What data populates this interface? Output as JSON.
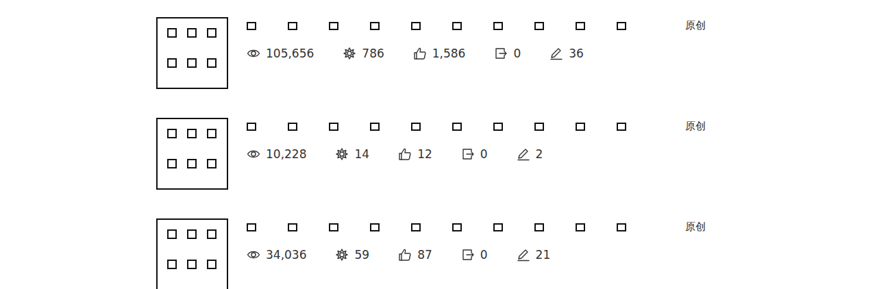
{
  "articles": [
    {
      "tag": "原创",
      "stats": [
        {
          "kind": "views",
          "value": "105,656"
        },
        {
          "kind": "recommends",
          "value": "786"
        },
        {
          "kind": "likes",
          "value": "1,586"
        },
        {
          "kind": "shares",
          "value": "0"
        },
        {
          "kind": "comments",
          "value": "36"
        }
      ]
    },
    {
      "tag": "原创",
      "stats": [
        {
          "kind": "views",
          "value": "10,228"
        },
        {
          "kind": "recommends",
          "value": "14"
        },
        {
          "kind": "likes",
          "value": "12"
        },
        {
          "kind": "shares",
          "value": "0"
        },
        {
          "kind": "comments",
          "value": "2"
        }
      ]
    },
    {
      "tag": "原创",
      "stats": [
        {
          "kind": "views",
          "value": "34,036"
        },
        {
          "kind": "recommends",
          "value": "59"
        },
        {
          "kind": "likes",
          "value": "87"
        },
        {
          "kind": "shares",
          "value": "0"
        },
        {
          "kind": "comments",
          "value": "21"
        }
      ]
    }
  ]
}
